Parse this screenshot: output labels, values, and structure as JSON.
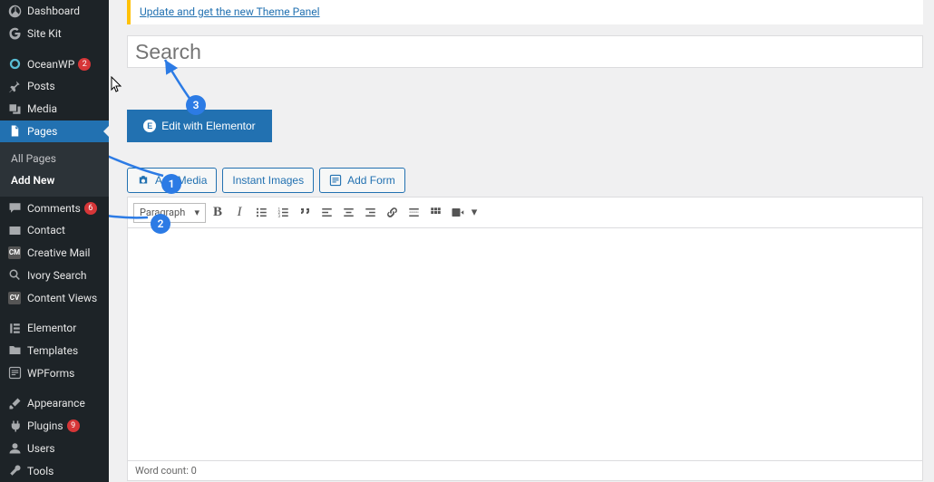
{
  "sidebar": {
    "dashboard": "Dashboard",
    "sitekit": "Site Kit",
    "oceanwp": {
      "label": "OceanWP",
      "badge": 2
    },
    "posts": "Posts",
    "media": "Media",
    "pages": "Pages",
    "sub_all": "All Pages",
    "sub_new": "Add New",
    "comments": {
      "label": "Comments",
      "badge": 6
    },
    "contact": "Contact",
    "creative_mail": "Creative Mail",
    "ivory": "Ivory Search",
    "cviews": "Content Views",
    "elementor": "Elementor",
    "templates": "Templates",
    "wpforms": "WPForms",
    "appearance": "Appearance",
    "plugins": {
      "label": "Plugins",
      "badge": 9
    },
    "users": "Users",
    "tools": "Tools"
  },
  "notice": {
    "link": "Update and get the new Theme Panel"
  },
  "editor": {
    "title_placeholder": "Search",
    "elementor_btn": "Edit with Elementor",
    "add_media": "Add Media",
    "instant_images": "Instant Images",
    "add_form": "Add Form",
    "paragraph": "Paragraph",
    "wordcount": "Word count: 0"
  },
  "annotations": {
    "n1": "1",
    "n2": "2",
    "n3": "3"
  }
}
